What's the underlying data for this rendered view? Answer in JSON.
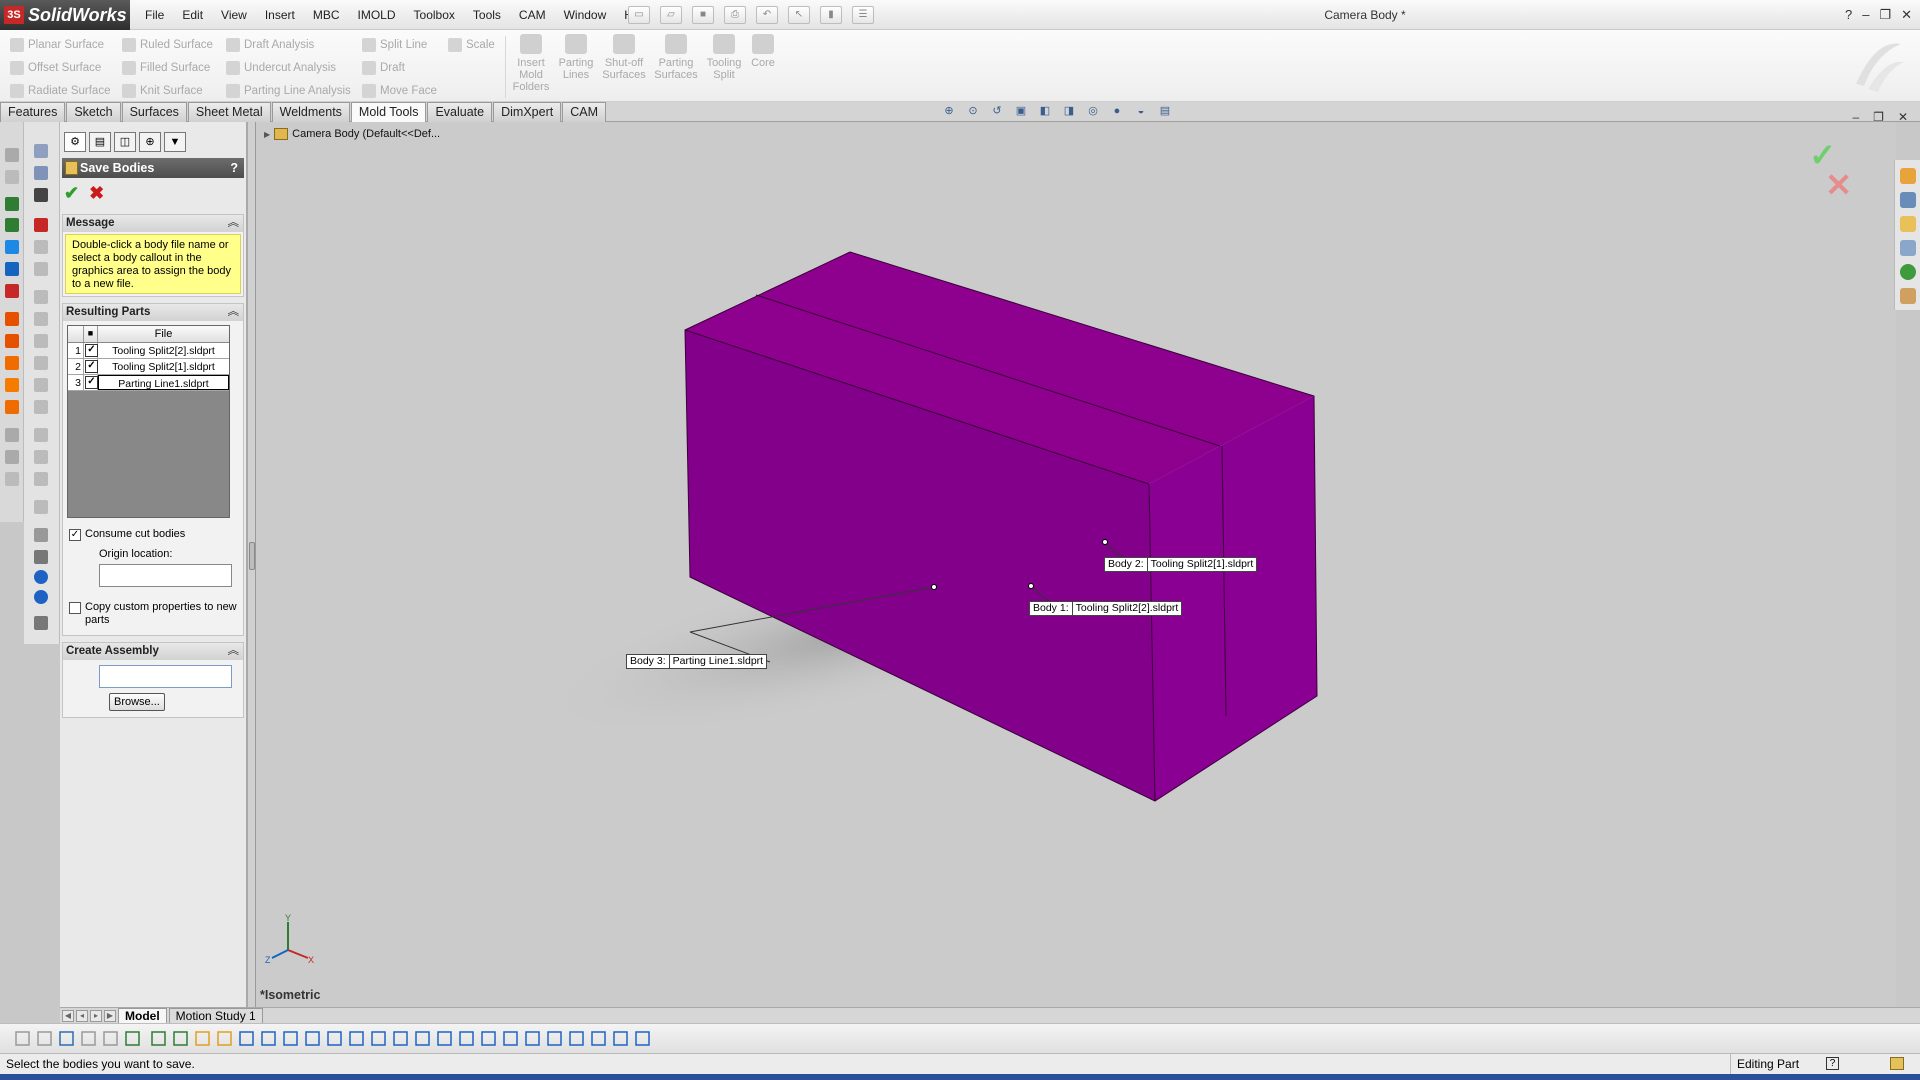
{
  "app": {
    "brand": "SolidWorks",
    "document_title": "Camera Body *",
    "menus": [
      "File",
      "Edit",
      "View",
      "Insert",
      "MBC",
      "IMOLD",
      "Toolbox",
      "Tools",
      "CAM",
      "Window",
      "Help"
    ],
    "window_controls": [
      "?",
      "–",
      "❐",
      "✕"
    ]
  },
  "command_manager": {
    "col1": [
      "Planar Surface",
      "Offset Surface",
      "Radiate Surface"
    ],
    "col2": [
      "Ruled Surface",
      "Filled Surface",
      "Knit Surface"
    ],
    "col3": [
      "Draft Analysis",
      "Undercut Analysis",
      "Parting Line Analysis"
    ],
    "col4": [
      "Split Line",
      "Draft",
      "Move Face"
    ],
    "col5": [
      "Scale"
    ],
    "big_buttons": [
      {
        "label": "Insert Mold Folders"
      },
      {
        "label": "Parting Lines"
      },
      {
        "label": "Shut-off Surfaces"
      },
      {
        "label": "Parting Surfaces"
      },
      {
        "label": "Tooling Split"
      },
      {
        "label": "Core"
      }
    ]
  },
  "tabs": [
    {
      "label": "Features",
      "active": false
    },
    {
      "label": "Sketch",
      "active": false
    },
    {
      "label": "Surfaces",
      "active": false
    },
    {
      "label": "Sheet Metal",
      "active": false
    },
    {
      "label": "Weldments",
      "active": false
    },
    {
      "label": "Mold Tools",
      "active": true
    },
    {
      "label": "Evaluate",
      "active": false
    },
    {
      "label": "DimXpert",
      "active": false
    },
    {
      "label": "CAM",
      "active": false
    }
  ],
  "property_manager": {
    "title": "Save Bodies",
    "help": "?",
    "ok": "✔",
    "cancel": "✖",
    "message": {
      "title": "Message",
      "text": "Double-click a body file name or select a body callout in the graphics area to assign the body to a new file."
    },
    "resulting_parts": {
      "title": "Resulting Parts",
      "column_file": "File",
      "rows": [
        {
          "num": "1",
          "file": "Tooling Split2[2].sldprt",
          "checked": true,
          "selected": false
        },
        {
          "num": "2",
          "file": "Tooling Split2[1].sldprt",
          "checked": true,
          "selected": false
        },
        {
          "num": "3",
          "file": "Parting Line1.sldprt",
          "checked": true,
          "selected": true
        }
      ],
      "consume_cut_bodies": "Consume cut bodies",
      "origin_location": "Origin location:",
      "copy_custom_properties": "Copy custom properties to new parts"
    },
    "create_assembly": {
      "title": "Create Assembly",
      "browse": "Browse..."
    }
  },
  "graphics": {
    "tree_root": "Camera Body  (Default<<Def...",
    "view_orientation": "*Isometric",
    "body_color": "#8e008e",
    "callouts": [
      {
        "body": "Body  2:",
        "file": "Tooling Split2[1].sldprt"
      },
      {
        "body": "Body  1:",
        "file": "Tooling Split2[2].sldprt"
      },
      {
        "body": "Body  3:",
        "file": "Parting Line1.sldprt"
      }
    ],
    "triad": {
      "x": "X",
      "y": "Y",
      "z": "Z"
    }
  },
  "bottom_tabs": [
    {
      "label": "Model",
      "active": true
    },
    {
      "label": "Motion Study 1",
      "active": false
    }
  ],
  "status": {
    "message": "Select the bodies you want to save.",
    "mode": "Editing Part",
    "help": "?"
  }
}
